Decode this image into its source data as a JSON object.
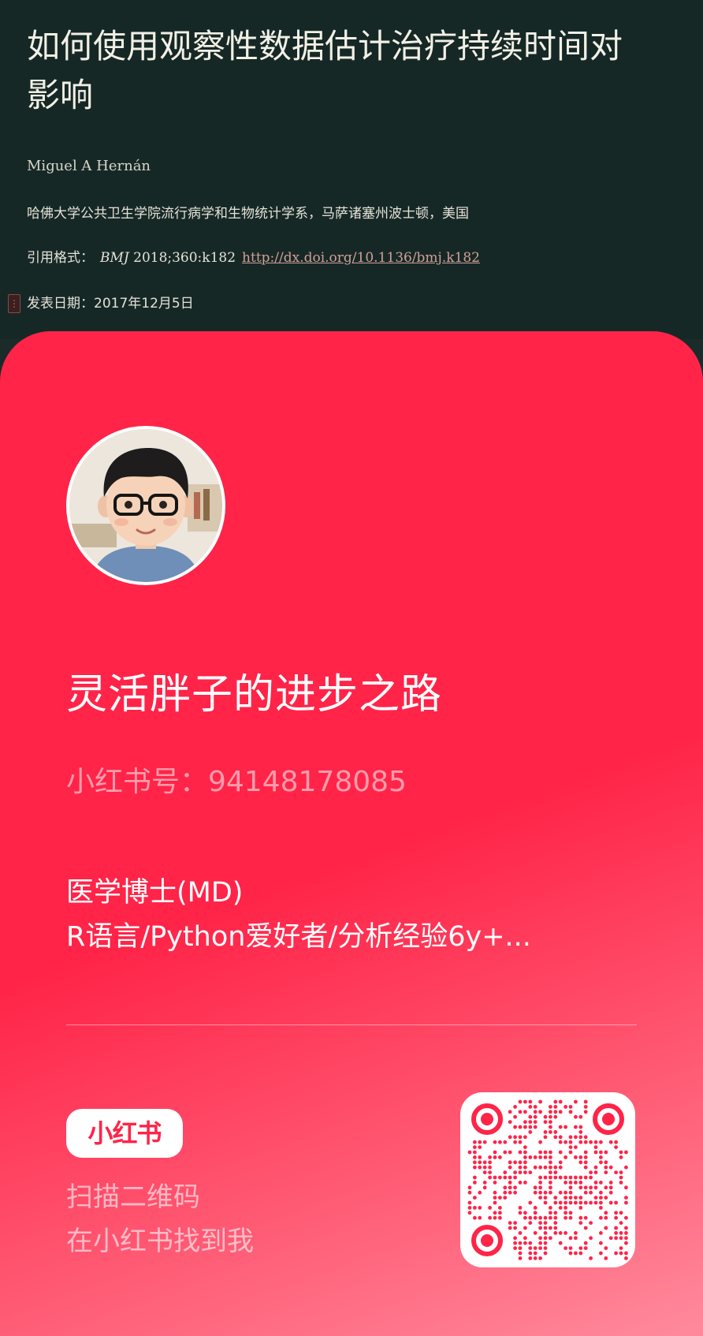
{
  "article": {
    "title_line1": "如何使用观察性数据估计治疗持续时间对",
    "title_line2": "影响",
    "author": "Miguel A Hernán",
    "affiliation": "哈佛大学公共卫生学院流行病学和生物统计学系，马萨诸塞州波士顿，美国",
    "citation_label": "引用格式：",
    "citation_journal": "BMJ",
    "citation_ref": " 2018;360:k182",
    "citation_doi": "http://dx.doi.org/10.1136/bmj.k182",
    "publish_label": "发表日期：2017年12月5日",
    "side_marker": "⋮"
  },
  "profile": {
    "name": "灵活胖子的进步之路",
    "id_text": "小红书号：94148178085",
    "bio_line1": "医学博士(MD)",
    "bio_line2": "R语言/Python爱好者/分析经验6y+..."
  },
  "footer": {
    "brand": "小红书",
    "scan_line1": "扫描二维码",
    "scan_line2": "在小红书找到我"
  },
  "colors": {
    "card_red": "#ff2448",
    "header_bg": "#162826"
  }
}
